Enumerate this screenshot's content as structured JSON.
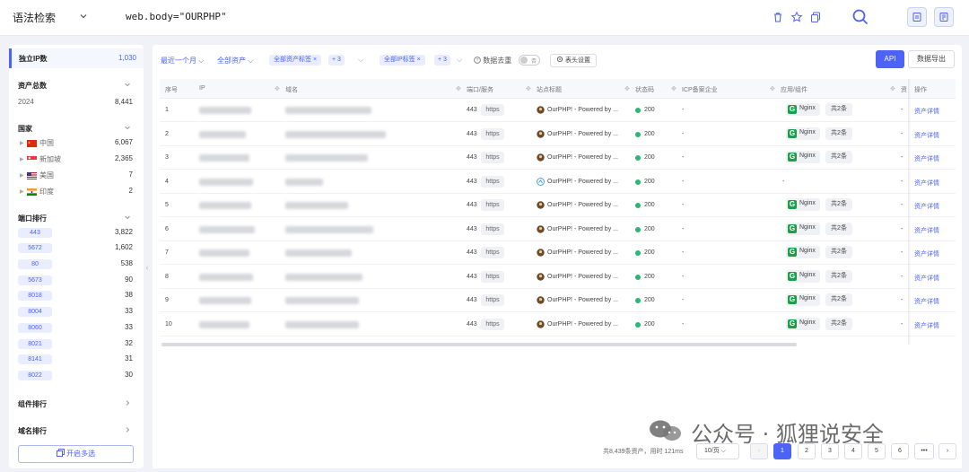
{
  "topbar": {
    "mode": "语法检索",
    "query": "web.body=\"OURPHP\""
  },
  "sidebar": {
    "header_label": "独立IP数",
    "header_value": "1,030",
    "assets": {
      "title": "资产总数",
      "year": "2024",
      "value": "8,441"
    },
    "country": {
      "title": "国家",
      "items": [
        {
          "name": "中国",
          "value": "6,067"
        },
        {
          "name": "新加坡",
          "value": "2,365"
        },
        {
          "name": "美国",
          "value": "7"
        },
        {
          "name": "印度",
          "value": "2"
        }
      ]
    },
    "ports": {
      "title": "端口排行",
      "items": [
        {
          "port": "443",
          "value": "3,822"
        },
        {
          "port": "5672",
          "value": "1,602"
        },
        {
          "port": "80",
          "value": "538"
        },
        {
          "port": "5673",
          "value": "90"
        },
        {
          "port": "8018",
          "value": "38"
        },
        {
          "port": "8004",
          "value": "33"
        },
        {
          "port": "8060",
          "value": "33"
        },
        {
          "port": "8021",
          "value": "32"
        },
        {
          "port": "8141",
          "value": "31"
        },
        {
          "port": "8022",
          "value": "30"
        }
      ]
    },
    "component_rank": "组件排行",
    "domain_rank": "域名排行",
    "multi_select": "开启多选"
  },
  "filters": {
    "time": "最近一个月",
    "asset_type": "全部资产",
    "asset_tag": "全部资产标签",
    "asset_tag_more": "+ 3",
    "ip_tag": "全部IP标签",
    "ip_tag_more": "+ 3",
    "dedupe_label": "数据去重",
    "dedupe_state": "否",
    "column_settings": "表头设置",
    "api": "API",
    "export": "数据导出"
  },
  "table": {
    "headers": [
      "序号",
      "IP",
      "域名",
      "端口/服务",
      "站点标题",
      "状态码",
      "ICP备案企业",
      "应用/组件",
      "资",
      "操作"
    ],
    "rows": [
      {
        "no": "1",
        "port": "443",
        "svc": "https",
        "title": "OurPHP! - Powered by ...",
        "status": "200",
        "icp": "-",
        "app": "Nginx",
        "more": "共2条",
        "last": "-",
        "op": "资产详情"
      },
      {
        "no": "2",
        "port": "443",
        "svc": "https",
        "title": "OurPHP! - Powered by ...",
        "status": "200",
        "icp": "-",
        "app": "Nginx",
        "more": "共2条",
        "last": "-",
        "op": "资产详情"
      },
      {
        "no": "3",
        "port": "443",
        "svc": "https",
        "title": "OurPHP! - Powered by ...",
        "status": "200",
        "icp": "-",
        "app": "Nginx",
        "more": "共2条",
        "last": "-",
        "op": "资产详情"
      },
      {
        "no": "4",
        "port": "443",
        "svc": "https",
        "title": "OurPHP! - Powered by ...",
        "status": "200",
        "icp": "-",
        "app": "",
        "more": "",
        "app_dash": "-",
        "last": "-",
        "op": "资产详情"
      },
      {
        "no": "5",
        "port": "443",
        "svc": "https",
        "title": "OurPHP! - Powered by ...",
        "status": "200",
        "icp": "-",
        "app": "Nginx",
        "more": "共2条",
        "last": "-",
        "op": "资产详情"
      },
      {
        "no": "6",
        "port": "443",
        "svc": "https",
        "title": "OurPHP! - Powered by ...",
        "status": "200",
        "icp": "-",
        "app": "Nginx",
        "more": "共2条",
        "last": "-",
        "op": "资产详情"
      },
      {
        "no": "7",
        "port": "443",
        "svc": "https",
        "title": "OurPHP! - Powered by ...",
        "status": "200",
        "icp": "-",
        "app": "Nginx",
        "more": "共2条",
        "last": "-",
        "op": "资产详情"
      },
      {
        "no": "8",
        "port": "443",
        "svc": "https",
        "title": "OurPHP! - Powered by ...",
        "status": "200",
        "icp": "-",
        "app": "Nginx",
        "more": "共2条",
        "last": "-",
        "op": "资产详情"
      },
      {
        "no": "9",
        "port": "443",
        "svc": "https",
        "title": "OurPHP! - Powered by ...",
        "status": "200",
        "icp": "-",
        "app": "Nginx",
        "more": "共2条",
        "last": "-",
        "op": "资产详情"
      },
      {
        "no": "10",
        "port": "443",
        "svc": "https",
        "title": "OurPHP! - Powered by ...",
        "status": "200",
        "icp": "-",
        "app": "Nginx",
        "more": "共2条",
        "last": "-",
        "op": "资产详情"
      }
    ]
  },
  "pagination": {
    "total": "共8,439条资产，用时 121ms",
    "per_page": "10/页",
    "pages": [
      "1",
      "2",
      "3",
      "4",
      "5",
      "6"
    ],
    "current": "1",
    "ellipsis": "•••"
  },
  "watermark": "公众号 · 狐狸说安全",
  "colors": {
    "accent": "#4c63f5",
    "status_ok": "#2bb673",
    "nginx": "#19a04b"
  }
}
